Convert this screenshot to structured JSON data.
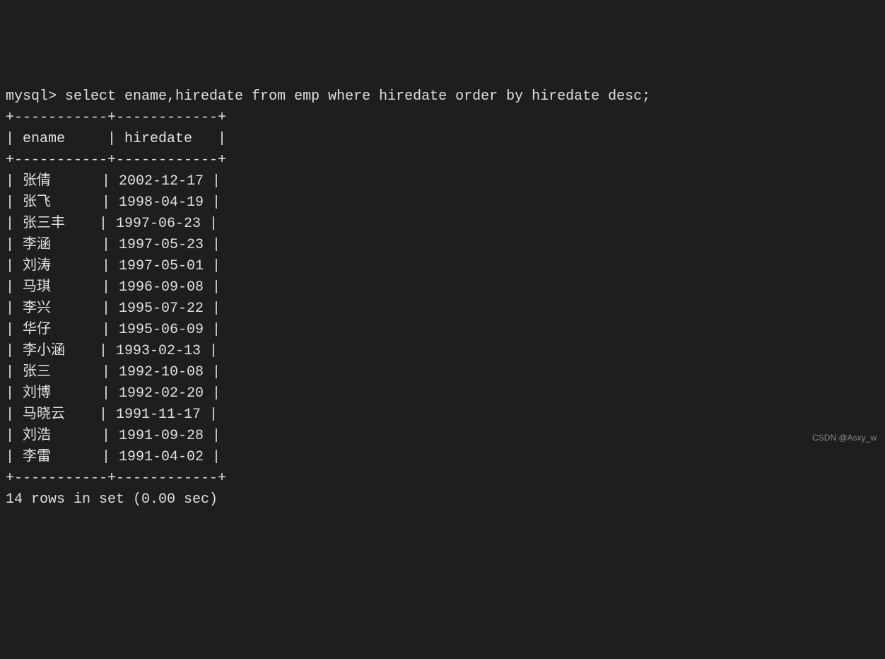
{
  "prompt": "mysql> ",
  "query": "select ename,hiredate from emp where hiredate order by hiredate desc;",
  "table": {
    "border_top": "+-----------+------------+",
    "header_row": "| ename     | hiredate   |",
    "border_mid": "+-----------+------------+",
    "rows": [
      "| 张倩      | 2002-12-17 |",
      "| 张飞      | 1998-04-19 |",
      "| 张三丰    | 1997-06-23 |",
      "| 李涵      | 1997-05-23 |",
      "| 刘涛      | 1997-05-01 |",
      "| 马琪      | 1996-09-08 |",
      "| 李兴      | 1995-07-22 |",
      "| 华仔      | 1995-06-09 |",
      "| 李小涵    | 1993-02-13 |",
      "| 张三      | 1992-10-08 |",
      "| 刘博      | 1992-02-20 |",
      "| 马晓云    | 1991-11-17 |",
      "| 刘浩      | 1991-09-28 |",
      "| 李雷      | 1991-04-02 |"
    ],
    "border_bot": "+-----------+------------+"
  },
  "chart_data": {
    "type": "table",
    "columns": [
      "ename",
      "hiredate"
    ],
    "data": [
      {
        "ename": "张倩",
        "hiredate": "2002-12-17"
      },
      {
        "ename": "张飞",
        "hiredate": "1998-04-19"
      },
      {
        "ename": "张三丰",
        "hiredate": "1997-06-23"
      },
      {
        "ename": "李涵",
        "hiredate": "1997-05-23"
      },
      {
        "ename": "刘涛",
        "hiredate": "1997-05-01"
      },
      {
        "ename": "马琪",
        "hiredate": "1996-09-08"
      },
      {
        "ename": "李兴",
        "hiredate": "1995-07-22"
      },
      {
        "ename": "华仔",
        "hiredate": "1995-06-09"
      },
      {
        "ename": "李小涵",
        "hiredate": "1993-02-13"
      },
      {
        "ename": "张三",
        "hiredate": "1992-10-08"
      },
      {
        "ename": "刘博",
        "hiredate": "1992-02-20"
      },
      {
        "ename": "马晓云",
        "hiredate": "1991-11-17"
      },
      {
        "ename": "刘浩",
        "hiredate": "1991-09-28"
      },
      {
        "ename": "李雷",
        "hiredate": "1991-04-02"
      }
    ]
  },
  "result_summary": "14 rows in set (0.00 sec)",
  "watermark": "CSDN @Asxy_w"
}
